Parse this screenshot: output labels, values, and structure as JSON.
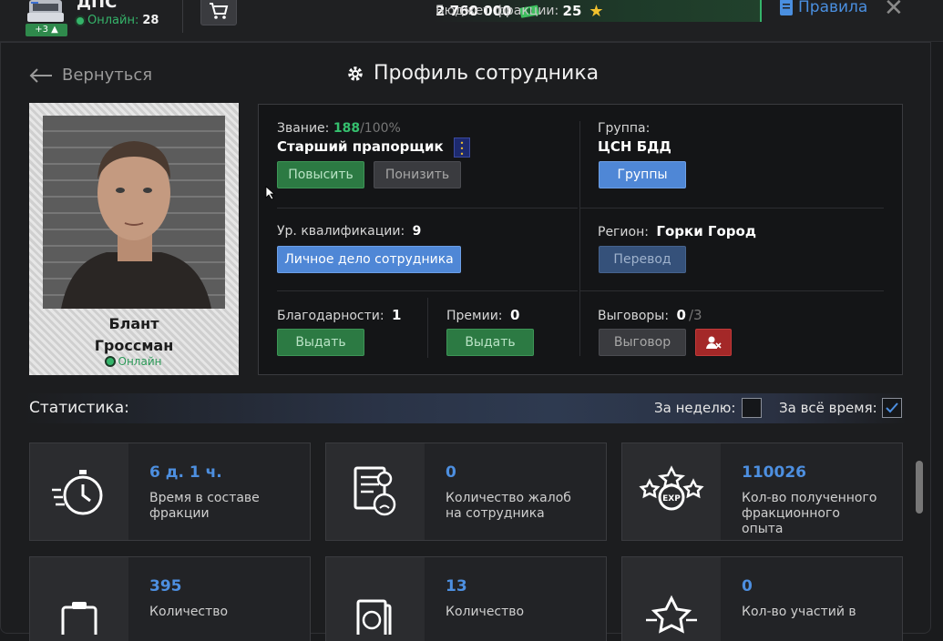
{
  "topbar": {
    "dept_name": "ДПС",
    "badge": "+3",
    "online_label": "Онлайн:",
    "online_count": "28",
    "budget_label": "Бюджет фракции:",
    "budget_value": "2 760 000",
    "stars_value": "25",
    "rules_label": "Правила"
  },
  "header": {
    "back_label": "Вернуться",
    "title": "Профиль сотрудника"
  },
  "employee": {
    "first_name": "Блант",
    "last_name": "Гроссман",
    "status": "Онлайн"
  },
  "info": {
    "rank_label": "Звание:",
    "rank_progress": "188",
    "rank_progress_max": "/100%",
    "rank_name": "Старший прапорщик",
    "promote_btn": "Повысить",
    "demote_btn": "Понизить",
    "group_label": "Группа:",
    "group_name": "ЦСН БДД",
    "groups_btn": "Группы",
    "qual_label": "Ур. квалификации:",
    "qual_value": "9",
    "file_btn": "Личное дело сотрудника",
    "region_label": "Регион:",
    "region_value": "Горки Город",
    "transfer_btn": "Перевод",
    "thanks_label": "Благодарности:",
    "thanks_value": "1",
    "thanks_btn": "Выдать",
    "bonus_label": "Премии:",
    "bonus_value": "0",
    "bonus_btn": "Выдать",
    "reprimand_label": "Выговоры:",
    "reprimand_value": "0",
    "reprimand_max": "/3",
    "reprimand_btn": "Выговор"
  },
  "stats": {
    "title": "Статистика:",
    "week_label": "За неделю:",
    "week_checked": false,
    "all_label": "За всё время:",
    "all_checked": true,
    "tiles": [
      {
        "icon": "stopwatch-icon",
        "value": "6 д. 1 ч.",
        "desc": "Время в составе фракции"
      },
      {
        "icon": "complaint-icon",
        "value": "0",
        "desc": "Количество жалоб на сотрудника"
      },
      {
        "icon": "exp-stars-icon",
        "value": "110026",
        "desc": "Кол-во полученного фракционного опыта"
      },
      {
        "icon": "clipboard-icon",
        "value": "395",
        "desc": "Количество"
      },
      {
        "icon": "ruble-docs-icon",
        "value": "13",
        "desc": "Количество"
      },
      {
        "icon": "star-icon",
        "value": "0",
        "desc": "Кол-во участий в"
      }
    ]
  },
  "colors": {
    "accent_blue": "#4d8fe0",
    "accent_green": "#35b46a",
    "danger_red": "#a42828"
  }
}
